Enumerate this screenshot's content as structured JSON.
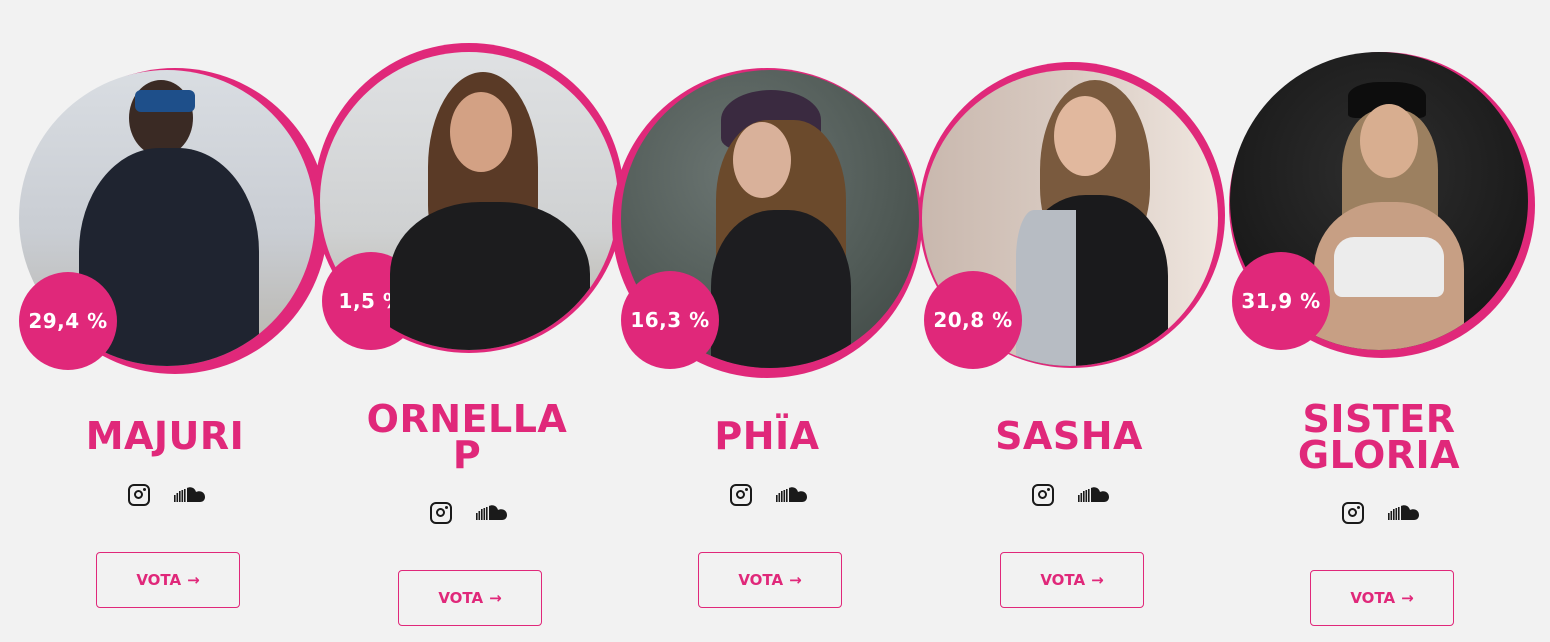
{
  "accent_color": "#e0287a",
  "candidates": [
    {
      "name_lines": [
        "MAJURI"
      ],
      "percent": "29,4 %",
      "vote_label": "VOTA",
      "vote_arrow": "→",
      "icons": [
        "instagram-icon",
        "soundcloud-icon"
      ]
    },
    {
      "name_lines": [
        "ORNELLA",
        "P"
      ],
      "percent": "1,5 %",
      "vote_label": "VOTA",
      "vote_arrow": "→",
      "icons": [
        "instagram-icon",
        "soundcloud-icon"
      ]
    },
    {
      "name_lines": [
        "PHÏA"
      ],
      "percent": "16,3 %",
      "vote_label": "VOTA",
      "vote_arrow": "→",
      "icons": [
        "instagram-icon",
        "soundcloud-icon"
      ]
    },
    {
      "name_lines": [
        "SASHA"
      ],
      "percent": "20,8 %",
      "vote_label": "VOTA",
      "vote_arrow": "→",
      "icons": [
        "instagram-icon",
        "soundcloud-icon"
      ]
    },
    {
      "name_lines": [
        "SISTER",
        "GLORIA"
      ],
      "percent": "31,9 %",
      "vote_label": "VOTA",
      "vote_arrow": "→",
      "icons": [
        "instagram-icon",
        "soundcloud-icon"
      ]
    }
  ]
}
